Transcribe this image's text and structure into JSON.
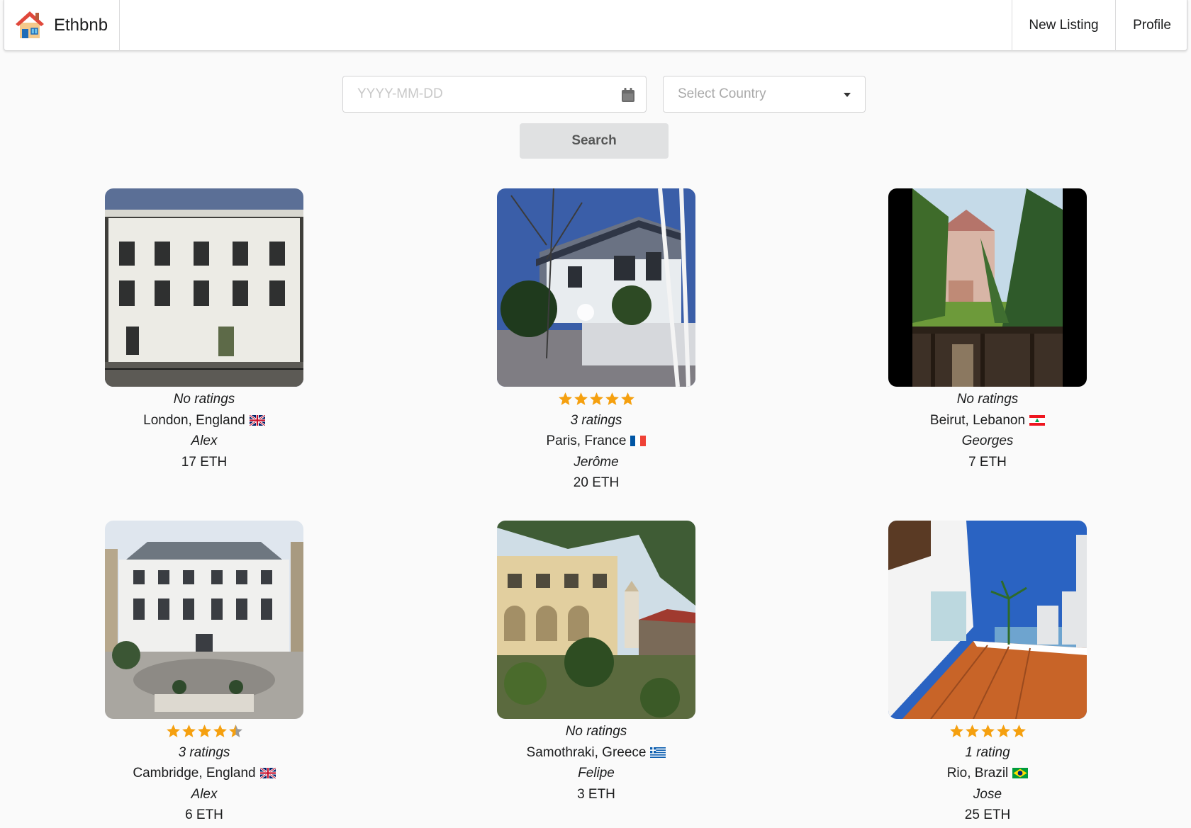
{
  "app": {
    "title": "Ethbnb",
    "nav": {
      "new_listing": "New Listing",
      "profile": "Profile"
    }
  },
  "search": {
    "date_placeholder": "YYYY-MM-DD",
    "country_placeholder": "Select Country",
    "button_label": "Search"
  },
  "colors": {
    "star": "#f5a00f",
    "star_empty": "#9a9a9a",
    "button_bg": "#e0e1e2"
  },
  "listings": [
    {
      "rating_stars": null,
      "ratings_text": "No ratings",
      "location": "London, England",
      "flag": "gb",
      "host": "Alex",
      "price": "17 ETH",
      "photo": "townhouse"
    },
    {
      "rating_stars": 5,
      "ratings_text": "3 ratings",
      "location": "Paris, France",
      "flag": "fr",
      "host": "Jerôme",
      "price": "20 ETH",
      "photo": "suburban-house"
    },
    {
      "rating_stars": null,
      "ratings_text": "No ratings",
      "location": "Beirut, Lebanon",
      "flag": "lb",
      "host": "Georges",
      "price": "7 ETH",
      "photo": "garden-house"
    },
    {
      "rating_stars": 4.5,
      "ratings_text": "3 ratings",
      "location": "Cambridge, England",
      "flag": "gb",
      "host": "Alex",
      "price": "6 ETH",
      "photo": "mansion"
    },
    {
      "rating_stars": null,
      "ratings_text": "No ratings",
      "location": "Samothraki, Greece",
      "flag": "gr",
      "host": "Felipe",
      "price": "3 ETH",
      "photo": "village-house"
    },
    {
      "rating_stars": 5,
      "ratings_text": "1 rating",
      "location": "Rio, Brazil",
      "flag": "br",
      "host": "Jose",
      "price": "25 ETH",
      "photo": "terrace"
    }
  ]
}
